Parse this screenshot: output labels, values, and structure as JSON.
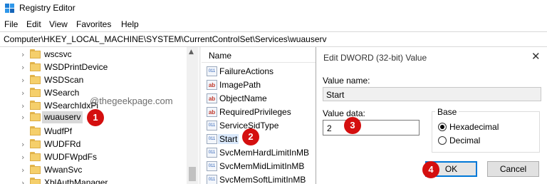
{
  "window": {
    "title": "Registry Editor",
    "icon": "registry-icon"
  },
  "menu": [
    "File",
    "Edit",
    "View",
    "Favorites",
    "Help"
  ],
  "address": "Computer\\HKEY_LOCAL_MACHINE\\SYSTEM\\CurrentControlSet\\Services\\wuauserv",
  "tree": {
    "items": [
      {
        "label": "wscsvc",
        "expandable": true
      },
      {
        "label": "WSDPrintDevice",
        "expandable": true
      },
      {
        "label": "WSDScan",
        "expandable": true
      },
      {
        "label": "WSearch",
        "expandable": true
      },
      {
        "label": "WSearchIdxPi",
        "expandable": true
      },
      {
        "label": "wuauserv",
        "expandable": true,
        "selected": true
      },
      {
        "label": "WudfPf",
        "expandable": false
      },
      {
        "label": "WUDFRd",
        "expandable": true
      },
      {
        "label": "WUDFWpdFs",
        "expandable": true
      },
      {
        "label": "WwanSvc",
        "expandable": true
      },
      {
        "label": "XblAuthManager",
        "expandable": true
      }
    ]
  },
  "watermark": "@thegeekpage.com",
  "values_list": {
    "column_name": "Name",
    "items": [
      {
        "name": "FailureActions",
        "type": "binary"
      },
      {
        "name": "ImagePath",
        "type": "string"
      },
      {
        "name": "ObjectName",
        "type": "string"
      },
      {
        "name": "RequiredPrivileges",
        "type": "string"
      },
      {
        "name": "ServiceSidType",
        "type": "binary"
      },
      {
        "name": "Start",
        "type": "binary",
        "selected": true
      },
      {
        "name": "SvcMemHardLimitInMB",
        "type": "binary"
      },
      {
        "name": "SvcMemMidLimitInMB",
        "type": "binary"
      },
      {
        "name": "SvcMemSoftLimitInMB",
        "type": "binary"
      }
    ]
  },
  "dialog": {
    "title": "Edit DWORD (32-bit) Value",
    "value_name_label": "Value name:",
    "value_name": "Start",
    "value_data_label": "Value data:",
    "value_data": "2",
    "base_label": "Base",
    "base_options": [
      {
        "label": "Hexadecimal",
        "checked": true
      },
      {
        "label": "Decimal",
        "checked": false
      }
    ],
    "ok_label": "OK",
    "cancel_label": "Cancel"
  },
  "steps": [
    "1",
    "2",
    "3",
    "4"
  ],
  "colors": {
    "step_badge": "#d40f0f",
    "accent": "#0078d7"
  }
}
